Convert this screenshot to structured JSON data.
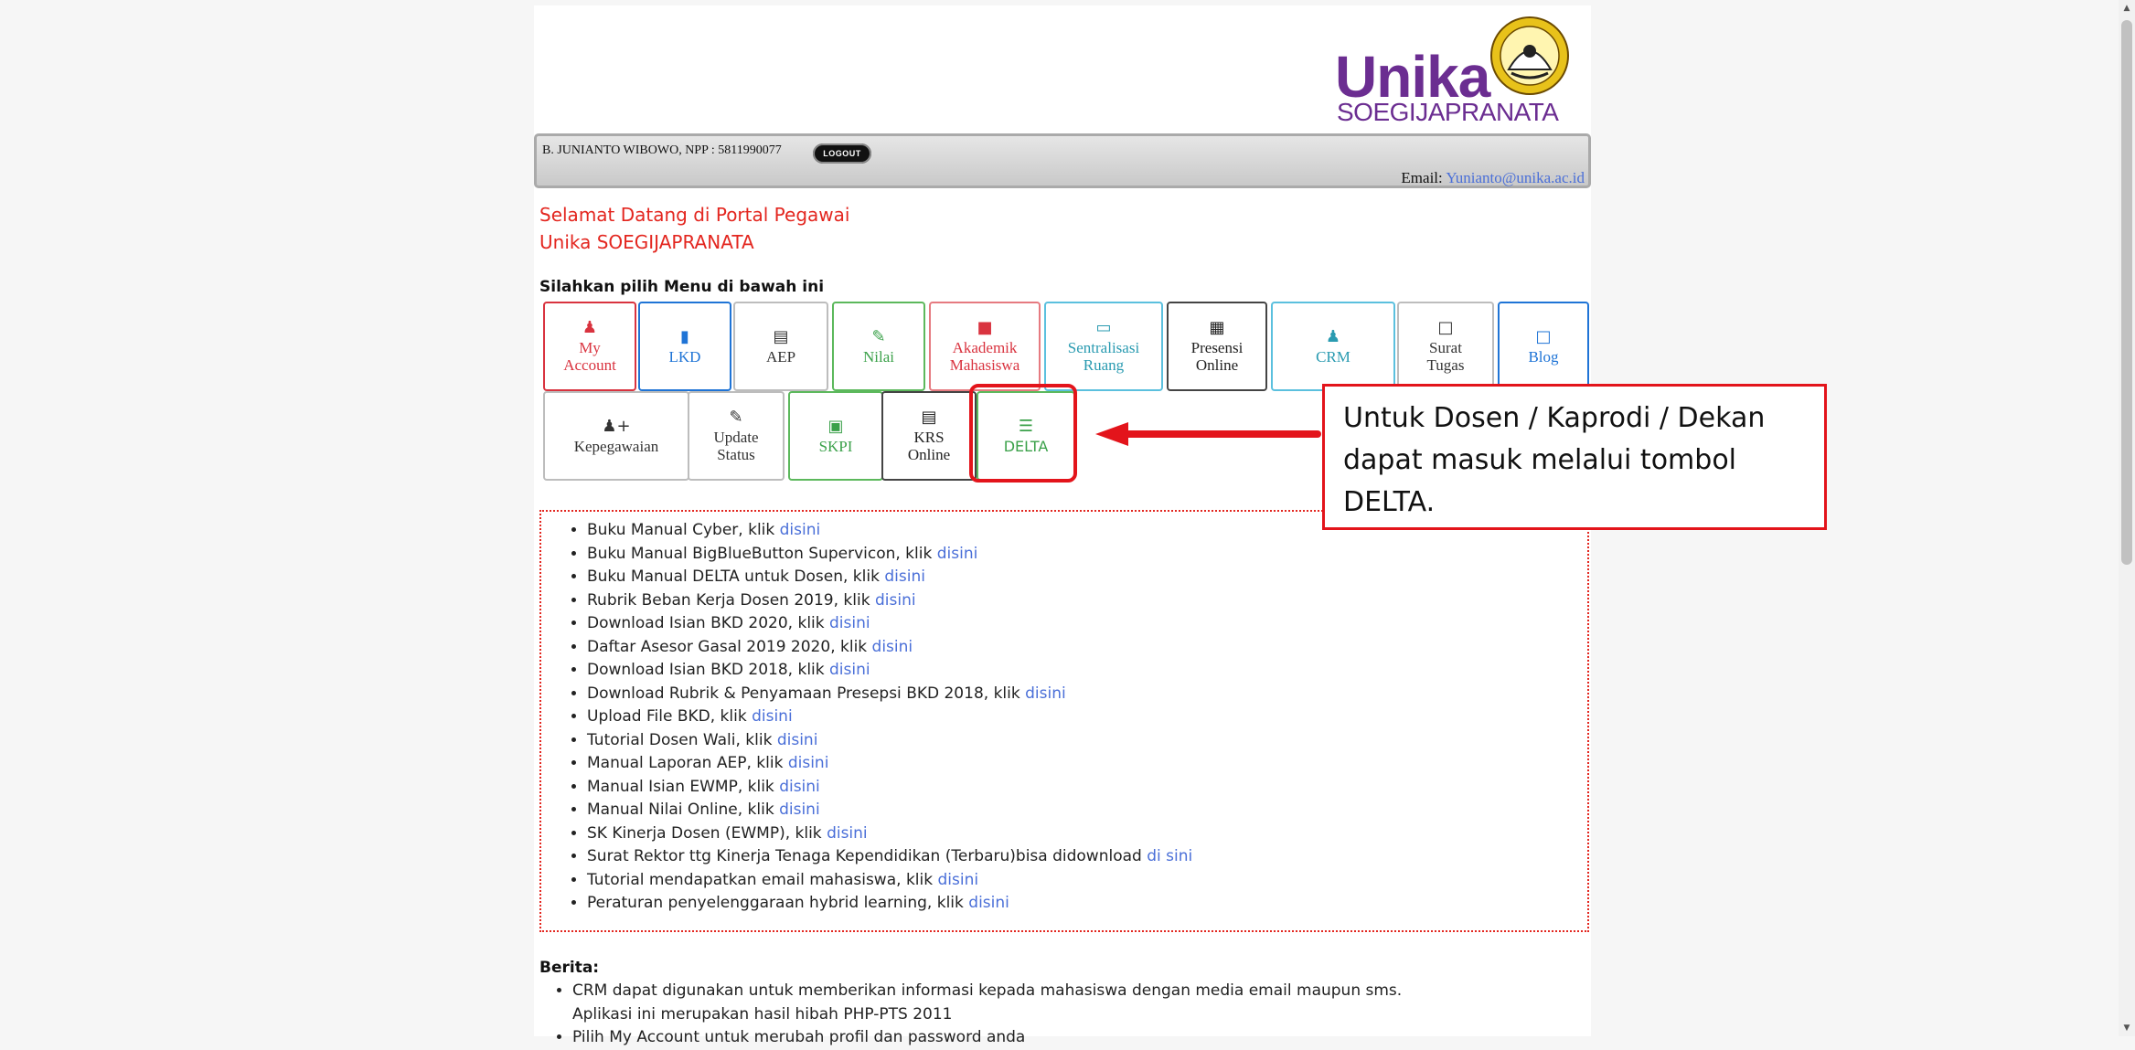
{
  "logo": {
    "word": "Unika",
    "sub": "SOEGIJAPRANATA"
  },
  "user": {
    "name": "B. JUNIANTO WIBOWO, NPP : 5811990077",
    "logout_label": "LOGOUT",
    "email_label": "Email:",
    "email": "Yunianto@unika.ac.id"
  },
  "welcome": {
    "line1": "Selamat Datang di Portal Pegawai",
    "line2": "Unika SOEGIJAPRANATA"
  },
  "menu_heading": "Silahkan pilih Menu di bawah ini",
  "menu": {
    "my_account": "My Account",
    "lkd": "LKD",
    "aep": "AEP",
    "nilai": "Nilai",
    "akademik": "Akademik Mahasiswa",
    "sentralisasi": "Sentralisasi Ruang",
    "presensi": "Presensi Online",
    "crm": "CRM",
    "surat": "Surat Tugas",
    "blog": "Blog",
    "kepegawaian": "Kepegawaian",
    "update": "Update Status",
    "skpi": "SKPI",
    "krs": "KRS Online",
    "delta": "DELTA"
  },
  "callout": {
    "text": "Untuk Dosen / Kaprodi / Dekan dapat masuk melalui tombol DELTA."
  },
  "links": [
    {
      "text": "Buku Manual Cyber, klik ",
      "link": "disini"
    },
    {
      "text": "Buku Manual BigBlueButton Supervicon, klik ",
      "link": "disini"
    },
    {
      "text": "Buku Manual DELTA untuk Dosen, klik ",
      "link": "disini"
    },
    {
      "text": "Rubrik Beban Kerja Dosen 2019, klik ",
      "link": "disini"
    },
    {
      "text": "Download Isian BKD 2020, klik ",
      "link": "disini"
    },
    {
      "text": "Daftar Asesor Gasal 2019 2020, klik ",
      "link": "disini"
    },
    {
      "text": "Download Isian BKD 2018, klik ",
      "link": "disini"
    },
    {
      "text": "Download Rubrik & Penyamaan Presepsi BKD 2018, klik ",
      "link": "disini"
    },
    {
      "text": "Upload File BKD, klik ",
      "link": "disini"
    },
    {
      "text": "Tutorial Dosen Wali, klik ",
      "link": "disini"
    },
    {
      "text": "Manual Laporan AEP, klik ",
      "link": "disini"
    },
    {
      "text": "Manual Isian EWMP, klik ",
      "link": "disini"
    },
    {
      "text": "Manual Nilai Online, klik ",
      "link": "disini"
    },
    {
      "text": "SK Kinerja Dosen (EWMP), klik ",
      "link": "disini"
    },
    {
      "text": "Surat Rektor ttg Kinerja Tenaga Kependidikan (Terbaru)bisa didownload ",
      "link": "di sini"
    },
    {
      "text": "Tutorial mendapatkan email mahasiswa, klik ",
      "link": "disini"
    },
    {
      "text": "Peraturan penyelenggaraan hybrid learning, klik ",
      "link": "disini"
    }
  ],
  "berita": {
    "title": "Berita:",
    "items": [
      {
        "line1": "CRM dapat digunakan untuk memberikan informasi kepada mahasiswa dengan media email maupun sms.",
        "line2": "Aplikasi ini merupakan hasil hibah PHP-PTS 2011"
      },
      {
        "line1": "Pilih My Account untuk merubah profil dan password anda",
        "line2": ""
      }
    ]
  },
  "colors": {
    "accent_red": "#e3141b",
    "brand_purple": "#6b2d91",
    "link_blue": "#4a6fd8"
  }
}
